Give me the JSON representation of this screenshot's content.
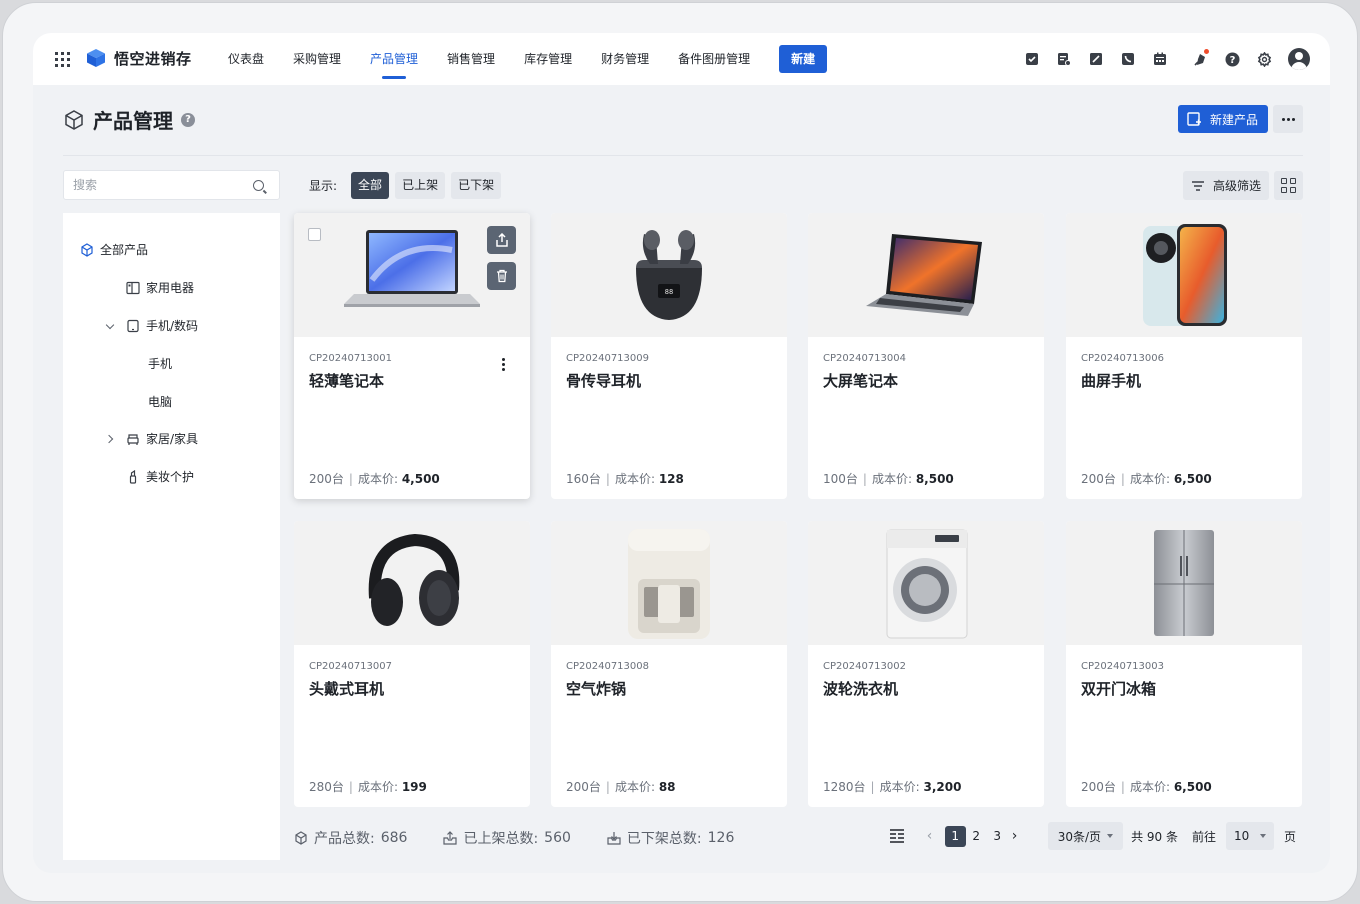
{
  "app": {
    "name": "悟空进销存"
  },
  "nav": {
    "items": [
      {
        "label": "仪表盘",
        "active": false
      },
      {
        "label": "采购管理",
        "active": false
      },
      {
        "label": "产品管理",
        "active": true
      },
      {
        "label": "销售管理",
        "active": false
      },
      {
        "label": "库存管理",
        "active": false
      },
      {
        "label": "财务管理",
        "active": false
      },
      {
        "label": "备件图册管理",
        "active": false
      }
    ],
    "new_label": "新建"
  },
  "toolbar_icons": [
    "task-icon",
    "report-icon",
    "edit-icon",
    "phone-icon",
    "calendar-icon",
    "notification-icon",
    "help-icon",
    "settings-icon",
    "user-avatar-icon"
  ],
  "page": {
    "title": "产品管理",
    "help": "?",
    "new_product_label": "新建产品"
  },
  "search": {
    "placeholder": "搜索"
  },
  "tree": {
    "root": "全部产品",
    "items": [
      {
        "label": "家用电器"
      },
      {
        "label": "手机/数码"
      },
      {
        "label": "手机"
      },
      {
        "label": "电脑"
      },
      {
        "label": "家居/家具"
      },
      {
        "label": "美妆个护"
      }
    ]
  },
  "filter": {
    "label": "显示:",
    "options": [
      "全部",
      "已上架",
      "已下架"
    ],
    "active": "全部",
    "advanced_label": "高级筛选"
  },
  "products": [
    {
      "code": "CP20240713001",
      "name": "轻薄笔记本",
      "qty": "200台",
      "cost_label": "成本价:",
      "cost": "4,500",
      "image": "laptop-thin"
    },
    {
      "code": "CP20240713009",
      "name": "骨传导耳机",
      "qty": "160台",
      "cost_label": "成本价:",
      "cost": "128",
      "image": "earbuds"
    },
    {
      "code": "CP20240713004",
      "name": "大屏笔记本",
      "qty": "100台",
      "cost_label": "成本价:",
      "cost": "8,500",
      "image": "laptop-large"
    },
    {
      "code": "CP20240713006",
      "name": "曲屏手机",
      "qty": "200台",
      "cost_label": "成本价:",
      "cost": "6,500",
      "image": "phone"
    },
    {
      "code": "CP20240713007",
      "name": "头戴式耳机",
      "qty": "280台",
      "cost_label": "成本价:",
      "cost": "199",
      "image": "headphones"
    },
    {
      "code": "CP20240713008",
      "name": "空气炸锅",
      "qty": "200台",
      "cost_label": "成本价:",
      "cost": "88",
      "image": "air-fryer"
    },
    {
      "code": "CP20240713002",
      "name": "波轮洗衣机",
      "qty": "1280台",
      "cost_label": "成本价:",
      "cost": "3,200",
      "image": "washing-machine"
    },
    {
      "code": "CP20240713003",
      "name": "双开门冰箱",
      "qty": "200台",
      "cost_label": "成本价:",
      "cost": "6,500",
      "image": "fridge"
    }
  ],
  "footer": {
    "total_label": "产品总数:",
    "total": "686",
    "on_label": "已上架总数:",
    "on": "560",
    "off_label": "已下架总数:",
    "off": "126"
  },
  "pager": {
    "pages": [
      "1",
      "2",
      "3"
    ],
    "current": "1",
    "page_size": "30条/页",
    "total_text": "共 90 条",
    "goto_label": "前往",
    "goto_value": "10",
    "page_suffix": "页"
  },
  "colors": {
    "accent": "#1f5fd6",
    "dark_chip": "#3b4656"
  }
}
